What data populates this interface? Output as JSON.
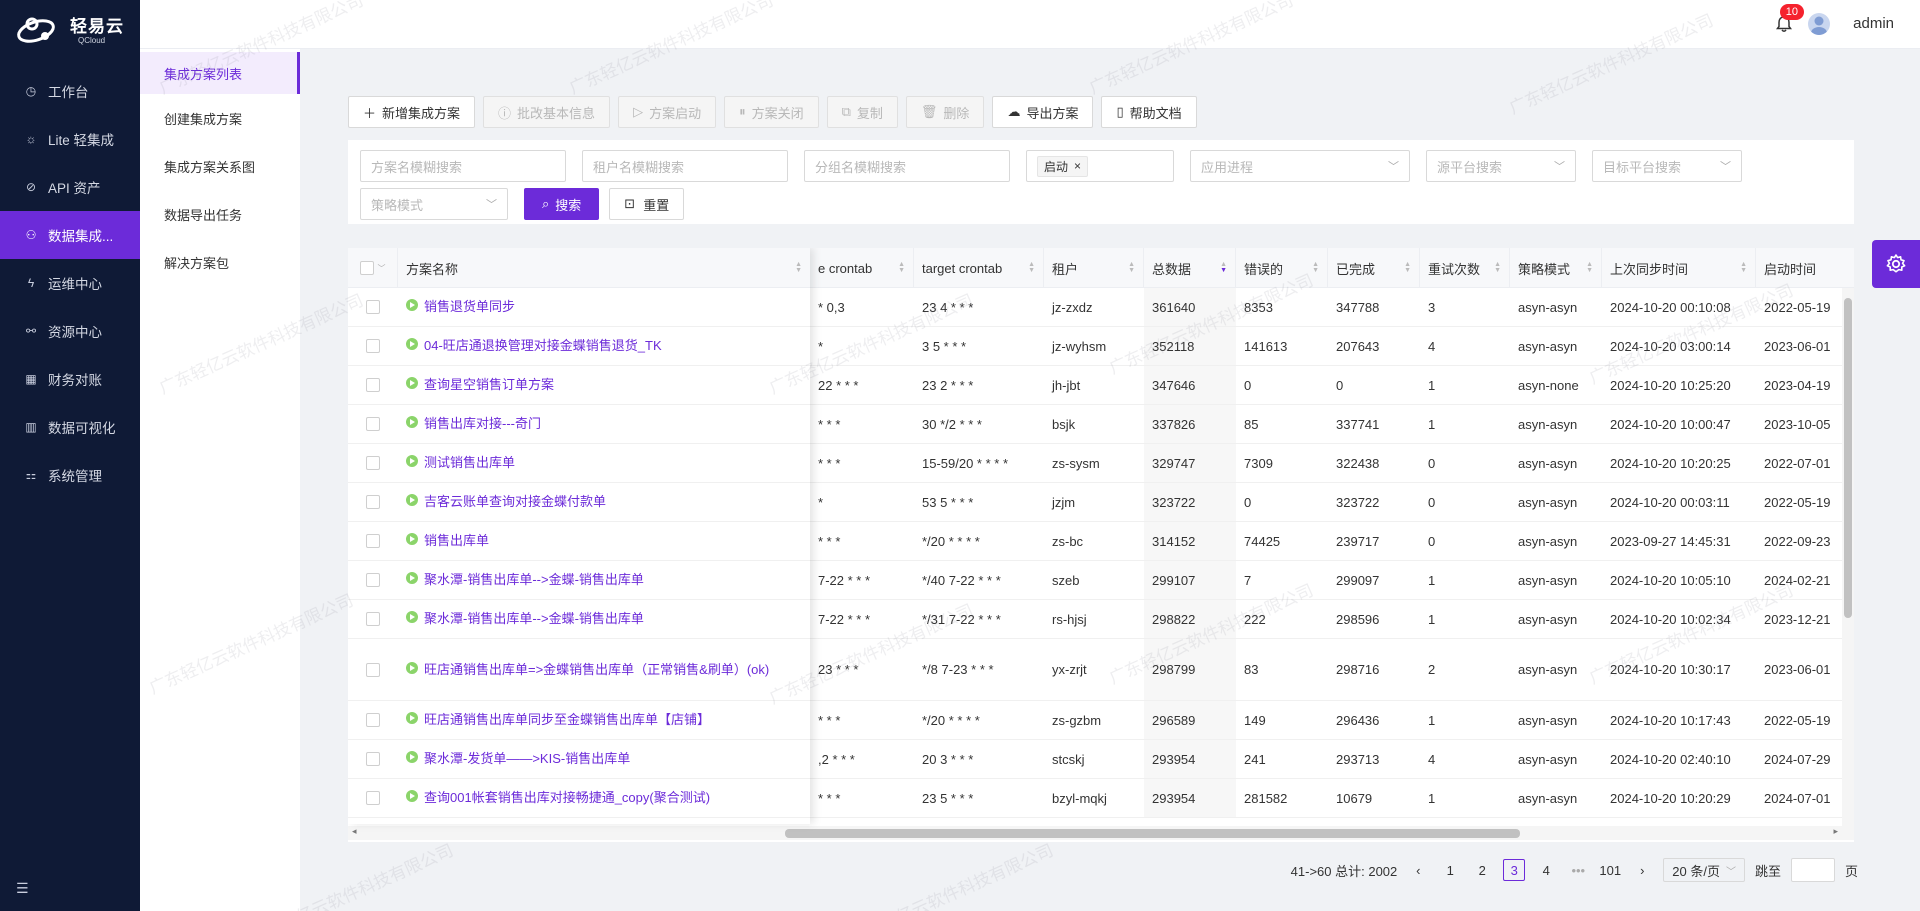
{
  "brand": {
    "name": "轻易云",
    "sub": "QCloud"
  },
  "nav": [
    {
      "label": "工作台",
      "icon": "clock-icon"
    },
    {
      "label": "Lite 轻集成",
      "icon": "bulb-icon"
    },
    {
      "label": "API 资产",
      "icon": "compass-icon"
    },
    {
      "label": "数据集成...",
      "icon": "integration-icon",
      "active": true
    },
    {
      "label": "运维中心",
      "icon": "bolt-icon"
    },
    {
      "label": "资源中心",
      "icon": "network-icon"
    },
    {
      "label": "财务对账",
      "icon": "ledger-icon"
    },
    {
      "label": "数据可视化",
      "icon": "chart-icon"
    },
    {
      "label": "系统管理",
      "icon": "settings-grid-icon"
    }
  ],
  "submenu": [
    {
      "label": "集成方案列表",
      "active": true
    },
    {
      "label": "创建集成方案"
    },
    {
      "label": "集成方案关系图"
    },
    {
      "label": "数据导出任务"
    },
    {
      "label": "解决方案包"
    }
  ],
  "header": {
    "notifications": "10",
    "user": "admin"
  },
  "toolbar": {
    "add": "新增集成方案",
    "batch": "批改基本信息",
    "start": "方案启动",
    "close": "方案关闭",
    "copy": "复制",
    "delete": "删除",
    "export": "导出方案",
    "help": "帮助文档"
  },
  "filters": {
    "scheme_name": "方案名模糊搜索",
    "tenant_name": "租户名模糊搜索",
    "group_name": "分组名模糊搜索",
    "status_tag": "启动",
    "app_process": "应用进程",
    "source_platform": "源平台搜索",
    "target_platform": "目标平台搜索",
    "strategy": "策略模式",
    "search": "搜索",
    "reset": "重置"
  },
  "table": {
    "headers": {
      "name": "方案名称",
      "source_crontab": "e crontab",
      "target_crontab": "target crontab",
      "tenant": "租户",
      "total": "总数据",
      "errors": "错误的",
      "done": "已完成",
      "retries": "重试次数",
      "strategy": "策略模式",
      "last_sync": "上次同步时间",
      "start_time": "启动时间"
    },
    "rows": [
      {
        "name": "销售退货单同步",
        "src": "* 0,3",
        "tgt": "23 4 * * *",
        "tenant": "jz-zxdz",
        "total": "361640",
        "err": "8353",
        "done": "347788",
        "retry": "3",
        "strategy": "asyn-asyn",
        "last": "2024-10-20 00:10:08",
        "start": "2022-05-19"
      },
      {
        "name": "04-旺店通退换管理对接金蝶销售退货_TK",
        "src": "*",
        "tgt": "3 5 * * *",
        "tenant": "jz-wyhsm",
        "total": "352118",
        "err": "141613",
        "done": "207643",
        "retry": "4",
        "strategy": "asyn-asyn",
        "last": "2024-10-20 03:00:14",
        "start": "2023-06-01"
      },
      {
        "name": "查询星空销售订单方案",
        "src": "22 * * *",
        "tgt": "23 2 * * *",
        "tenant": "jh-jbt",
        "total": "347646",
        "err": "0",
        "done": "0",
        "retry": "1",
        "strategy": "asyn-none",
        "last": "2024-10-20 10:25:20",
        "start": "2023-04-19"
      },
      {
        "name": "销售出库对接---奇门",
        "src": "* * *",
        "tgt": "30 */2 * * *",
        "tenant": "bsjk",
        "total": "337826",
        "err": "85",
        "done": "337741",
        "retry": "1",
        "strategy": "asyn-asyn",
        "last": "2024-10-20 10:00:47",
        "start": "2023-10-05"
      },
      {
        "name": "测试销售出库单",
        "src": "* * *",
        "tgt": "15-59/20 * * * *",
        "tenant": "zs-sysm",
        "total": "329747",
        "err": "7309",
        "done": "322438",
        "retry": "0",
        "strategy": "asyn-asyn",
        "last": "2024-10-20 10:20:25",
        "start": "2022-07-01"
      },
      {
        "name": "吉客云账单查询对接金蝶付款单",
        "src": "*",
        "tgt": "53 5 * * *",
        "tenant": "jzjm",
        "total": "323722",
        "err": "0",
        "done": "323722",
        "retry": "0",
        "strategy": "asyn-asyn",
        "last": "2024-10-20 00:03:11",
        "start": "2022-05-19"
      },
      {
        "name": "销售出库单",
        "src": "* * *",
        "tgt": "*/20 * * * *",
        "tenant": "zs-bc",
        "total": "314152",
        "err": "74425",
        "done": "239717",
        "retry": "0",
        "strategy": "asyn-asyn",
        "last": "2023-09-27 14:45:31",
        "start": "2022-09-23"
      },
      {
        "name": "聚水潭-销售出库单-->金蝶-销售出库单",
        "src": "7-22 * * *",
        "tgt": "*/40 7-22 * * *",
        "tenant": "szeb",
        "total": "299107",
        "err": "7",
        "done": "299097",
        "retry": "1",
        "strategy": "asyn-asyn",
        "last": "2024-10-20 10:05:10",
        "start": "2024-02-21"
      },
      {
        "name": "聚水潭-销售出库单-->金蝶-销售出库单",
        "src": "7-22 * * *",
        "tgt": "*/31 7-22 * * *",
        "tenant": "rs-hjsj",
        "total": "298822",
        "err": "222",
        "done": "298596",
        "retry": "1",
        "strategy": "asyn-asyn",
        "last": "2024-10-20 10:02:34",
        "start": "2023-12-21"
      },
      {
        "name": "旺店通销售出库单=>金蝶销售出库单（正常销售&刷单）(ok)",
        "src": "23 * * *",
        "tgt": "*/8 7-23 * * *",
        "tenant": "yx-zrjt",
        "total": "298799",
        "err": "83",
        "done": "298716",
        "retry": "2",
        "strategy": "asyn-asyn",
        "last": "2024-10-20 10:30:17",
        "start": "2023-06-01"
      },
      {
        "name": "旺店通销售出库单同步至金蝶销售出库单【店铺】",
        "src": "* * *",
        "tgt": "*/20 * * * *",
        "tenant": "zs-gzbm",
        "total": "296589",
        "err": "149",
        "done": "296436",
        "retry": "1",
        "strategy": "asyn-asyn",
        "last": "2024-10-20 10:17:43",
        "start": "2022-05-19"
      },
      {
        "name": "聚水潭-发货单——>KIS-销售出库单",
        "src": ",2 * * *",
        "tgt": "20 3 * * *",
        "tenant": "stcskj",
        "total": "293954",
        "err": "241",
        "done": "293713",
        "retry": "4",
        "strategy": "asyn-asyn",
        "last": "2024-10-20 02:40:10",
        "start": "2024-07-29"
      },
      {
        "name": "查询001帐套销售出库对接畅捷通_copy(聚合测试)",
        "src": "* * *",
        "tgt": "23 5 * * *",
        "tenant": "bzyl-mqkj",
        "total": "293954",
        "err": "281582",
        "done": "10679",
        "retry": "1",
        "strategy": "asyn-asyn",
        "last": "2024-10-20 10:20:29",
        "start": "2024-07-01"
      }
    ]
  },
  "pagination": {
    "range": "41->60 总计: 2002",
    "pages": [
      "1",
      "2",
      "3",
      "4",
      "•••",
      "101"
    ],
    "current": "3",
    "page_size": "20 条/页",
    "jump_label": "跳至",
    "page_unit": "页"
  },
  "watermark": "广东轻亿云软件科技有限公司",
  "colors": {
    "primary": "#6c2bd9",
    "sidebar": "#0f1a36",
    "status_on": "#8bd46a",
    "badge": "#f5222d"
  }
}
